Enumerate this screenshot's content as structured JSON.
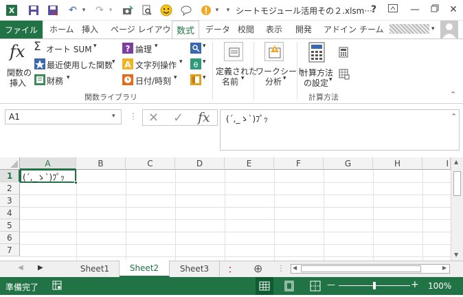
{
  "title": {
    "text": "シートモジュール活用その２.xlsm···",
    "help": "?",
    "minimize": "—",
    "close": "✕"
  },
  "tabs": {
    "file": "ファイル",
    "items": [
      "ホーム",
      "挿入",
      "ページ レイアウト",
      "数式",
      "データ",
      "校閲",
      "表示",
      "開発",
      "アドイン",
      "チーム"
    ],
    "active": "数式",
    "user": "▾"
  },
  "ribbon": {
    "insert_function": [
      "関数の",
      "挿入"
    ],
    "autosum": "オート SUM",
    "recent": "最近使用した関数",
    "financial": "財務",
    "logical": "論理",
    "text": "文字列操作",
    "datetime": "日付/時刻",
    "defined_names": [
      "定義された",
      "名前"
    ],
    "worksheet_analysis": [
      "ワークシート",
      "分析"
    ],
    "calc_options": [
      "計算方法",
      "の設定"
    ],
    "group_function_library": "関数ライブラリ",
    "group_calculation": "計算方法"
  },
  "formula_bar": {
    "name_box": "A1",
    "content": "(´,_ゝ`)ﾌﾟｯ",
    "fx": "fx"
  },
  "grid": {
    "columns": [
      "A",
      "B",
      "C",
      "D",
      "E",
      "F",
      "G",
      "H",
      "I"
    ],
    "rows": [
      "1",
      "2",
      "3",
      "4",
      "5",
      "6",
      "7"
    ],
    "a1_value": "(´,_ゝ`)ﾌﾟｯ"
  },
  "sheets": {
    "items": [
      "Sheet1",
      "Sheet2",
      "Sheet3"
    ],
    "active": "Sheet2",
    "more": "：",
    "add": "⊕"
  },
  "status": {
    "ready": "準備完了",
    "zoom": "100%",
    "minus": "—",
    "plus": "+"
  },
  "colors": {
    "accent": "#217346"
  }
}
